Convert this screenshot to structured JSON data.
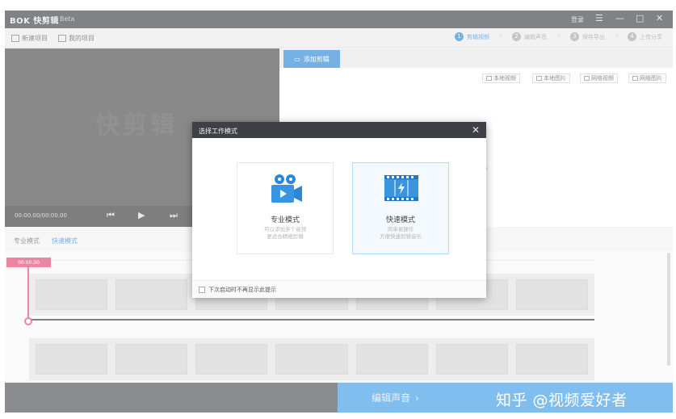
{
  "title_bar": {
    "logo": "BOK 快剪辑",
    "version": "Beta",
    "login": "登录",
    "menu_glyph": "☰",
    "minimize_glyph": "—",
    "maximize_glyph": "□",
    "close_glyph": "✕"
  },
  "toolbar": {
    "new_project": "新建项目",
    "my_project": "我的项目",
    "steps": [
      {
        "num": "1",
        "label": "剪辑视频"
      },
      {
        "num": "2",
        "label": "编辑声音"
      },
      {
        "num": "3",
        "label": "保存导出"
      },
      {
        "num": "4",
        "label": "上传分享"
      }
    ]
  },
  "preview": {
    "watermark": "快剪辑",
    "time": "00:00.00/00:00.00"
  },
  "right_pane": {
    "add_tab": "添加剪辑",
    "sources": [
      "本地视频",
      "本地图片",
      "网络视频",
      "网络图片"
    ],
    "hint": "片"
  },
  "mode_tabs": {
    "pro": "专业模式",
    "fast": "快速模式"
  },
  "timeline": {
    "playhead_time": "00:00.00"
  },
  "bottom": {
    "next_label": "编辑声音",
    "next_glyph": "›",
    "watermark": "知乎 @视频爱好者"
  },
  "modal": {
    "title": "选择工作模式",
    "close_glyph": "✕",
    "cards": [
      {
        "title": "专业模式",
        "desc1": "可以添加多个音频",
        "desc2": "更适合精细剪辑"
      },
      {
        "title": "快速模式",
        "desc1": "简单易操作",
        "desc2": "方便快速剪辑音乐"
      }
    ],
    "footer_checkbox": "下次启动时不再显示此提示"
  },
  "colors": {
    "accent": "#2b88d8",
    "playhead": "#e0446f",
    "titlebar": "#3e4046"
  }
}
